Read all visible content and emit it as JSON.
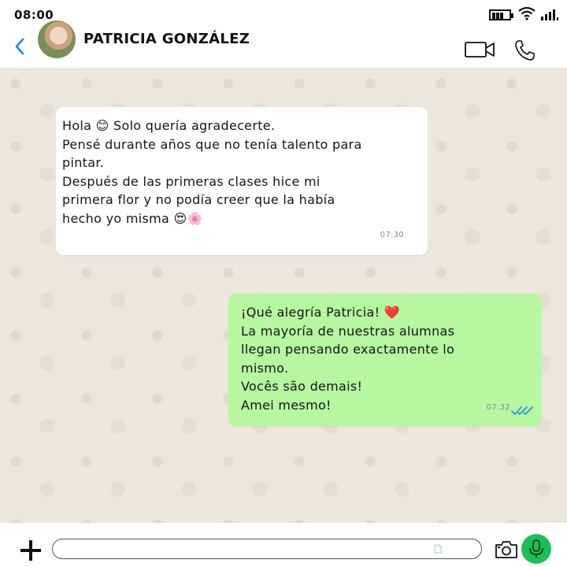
{
  "status_bar": {
    "time": "08:00",
    "icons": [
      "battery-icon",
      "wifi-icon",
      "signal-icon"
    ]
  },
  "header": {
    "contact_name": "PATRICIA GONZÁLEZ",
    "icons": [
      "back-chevron-icon",
      "avatar",
      "video-call-icon",
      "phone-icon"
    ],
    "accent_color": "#1e88e5"
  },
  "messages": [
    {
      "direction": "incoming",
      "lines": [
        "Hola 😊 Solo quería agradecerte.",
        "Pensé durante años que no tenía talento para",
        "pintar.",
        "Después de las primeras clases hice mi",
        "primera flor y no podía creer que la había",
        "hecho yo misma 😍🌸"
      ],
      "time": "07:30",
      "bubble_color": "#ffffff"
    },
    {
      "direction": "outgoing",
      "lines": [
        "¡Qué alegría Patricia! ❤️",
        "La mayoría de nuestras alumnas",
        "llegan pensando exactamente lo",
        "mismo.",
        "Vocês são demais!",
        "Amei mesmo!"
      ],
      "time": "07:32",
      "status_icon": "double-check-icon",
      "bubble_color": "#b6f7a0"
    }
  ],
  "input_bar": {
    "placeholder": "",
    "icons": [
      "plus-icon",
      "sticker-icon",
      "camera-icon",
      "microphone-icon"
    ],
    "mic_color": "#1cbf55"
  }
}
